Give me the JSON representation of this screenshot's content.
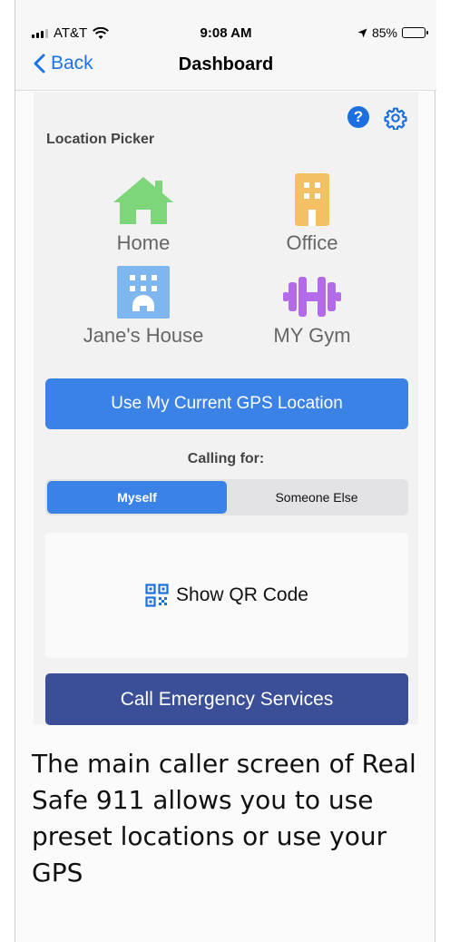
{
  "status_bar": {
    "carrier": "AT&T",
    "time": "9:08 AM",
    "battery": "85%",
    "battery_level": 0.85
  },
  "nav": {
    "back_label": "Back",
    "title": "Dashboard"
  },
  "toolbar": {
    "help_icon": "help-icon",
    "settings_icon": "gear-icon"
  },
  "location_picker": {
    "label": "Location Picker",
    "locations": [
      {
        "label": "Home",
        "icon": "house-icon",
        "color": "#7dd67a"
      },
      {
        "label": "Office",
        "icon": "office-building-icon",
        "color": "#f3c064"
      },
      {
        "label": "Jane's House",
        "icon": "apartment-icon",
        "color": "#7eb6f0"
      },
      {
        "label": "MY Gym",
        "icon": "dumbbell-icon",
        "color": "#b46be8"
      }
    ]
  },
  "gps_button": {
    "label": "Use My Current GPS Location"
  },
  "calling_for": {
    "label": "Calling for:",
    "options": [
      "Myself",
      "Someone Else"
    ],
    "selected": "Myself"
  },
  "qr": {
    "label": "Show QR Code",
    "icon": "qr-code-icon"
  },
  "call_button": {
    "label": "Call Emergency Services"
  },
  "caption": "The main caller screen of Real Safe 911 allows you to use preset locations or use your GPS",
  "colors": {
    "accent": "#3b82e6",
    "call_button": "#3b4f99",
    "back_link": "#1a73e8"
  }
}
